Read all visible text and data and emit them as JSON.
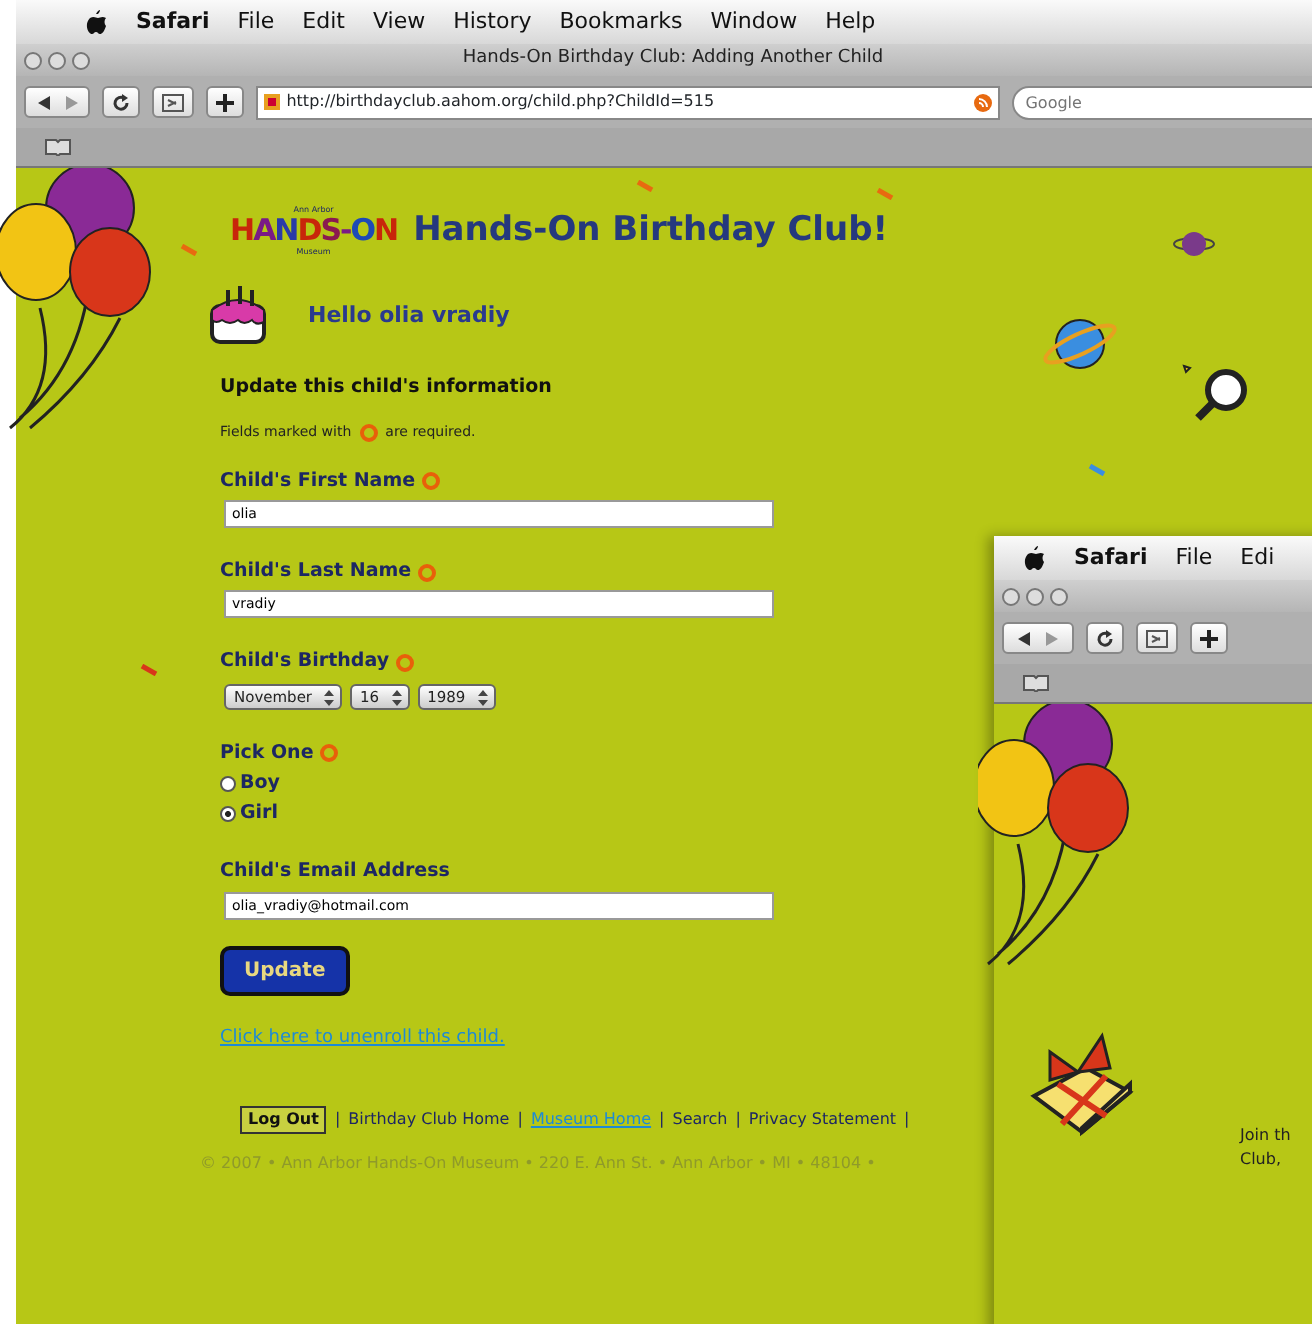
{
  "menu_bar": {
    "items": [
      "Safari",
      "File",
      "Edit",
      "View",
      "History",
      "Bookmarks",
      "Window",
      "Help"
    ]
  },
  "window": {
    "title": "Hands-On Birthday Club: Adding Another Child",
    "url": "http://birthdayclub.aahom.org/child.php?ChildId=515",
    "search_placeholder": "Google"
  },
  "page": {
    "logo": {
      "top": "Ann Arbor",
      "main": "HANDS-ON",
      "bottom": "Museum"
    },
    "site_title": "Hands-On Birthday Club!",
    "greeting": "Hello olia vradiy",
    "heading": "Update this child's information",
    "note_before": "Fields marked with",
    "note_after": "are required.",
    "fields": [
      {
        "kind": "text",
        "label": "Child's First Name",
        "required": true,
        "value": "olia"
      },
      {
        "kind": "text",
        "label": "Child's Last Name",
        "required": true,
        "value": "vradiy"
      },
      {
        "kind": "selects",
        "label": "Child's Birthday",
        "required": true,
        "options": [
          "November",
          "16",
          "1989"
        ]
      },
      {
        "kind": "radio",
        "label": "Pick One",
        "required": true,
        "choices": [
          {
            "label": "Boy",
            "selected": false
          },
          {
            "label": "Girl",
            "selected": true
          }
        ]
      },
      {
        "kind": "text",
        "label": "Child's Email Address",
        "required": false,
        "value": "olia_vradiy@hotmail.com"
      }
    ],
    "submit": "Update",
    "unenroll_link": "Click here to unenroll this child.",
    "footer": {
      "logout": "Log Out",
      "separator": "|",
      "links": [
        "Birthday Club Home",
        "Museum Home",
        "Search",
        "Privacy Statement"
      ],
      "copyright": "© 2007 • Ann Arbor Hands-On Museum • 220 E. Ann St. • Ann Arbor • MI • 48104 •"
    }
  },
  "second_window": {
    "menu_items": [
      "Safari",
      "File",
      "Edi"
    ],
    "page_text": [
      "Join th",
      "Club,"
    ]
  }
}
